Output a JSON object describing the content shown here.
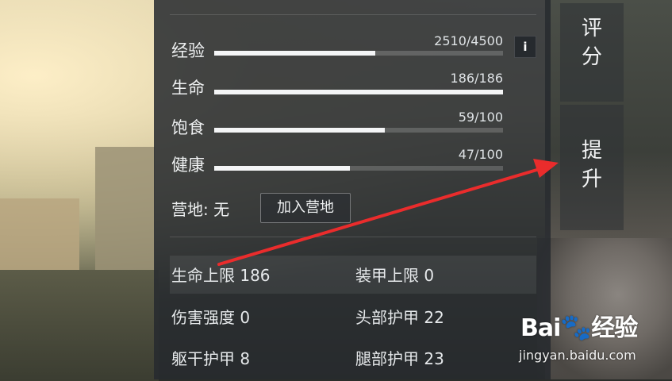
{
  "stats": [
    {
      "label": "经验",
      "value": "2510/4500",
      "fraction": 0.558
    },
    {
      "label": "生命",
      "value": "186/186",
      "fraction": 1.0
    },
    {
      "label": "饱食",
      "value": "59/100",
      "fraction": 0.59
    },
    {
      "label": "健康",
      "value": "47/100",
      "fraction": 0.47
    }
  ],
  "info_button": "i",
  "camp": {
    "label": "营地: 无",
    "button": "加入营地"
  },
  "attributes": [
    {
      "label": "生命上限 186"
    },
    {
      "label": "装甲上限 0"
    },
    {
      "label": "伤害强度 0"
    },
    {
      "label": "头部护甲 22"
    },
    {
      "label": "躯干护甲 8"
    },
    {
      "label": "腿部护甲 23"
    }
  ],
  "side": {
    "rate": [
      "评",
      "分"
    ],
    "upgrade": [
      "提",
      "升"
    ]
  },
  "watermark": {
    "brand_a": "Bai",
    "brand_b": "经验",
    "url": "jingyan.baidu.com"
  },
  "colors": {
    "arrow": "#ea2c2c",
    "panel": "#262a2e"
  }
}
